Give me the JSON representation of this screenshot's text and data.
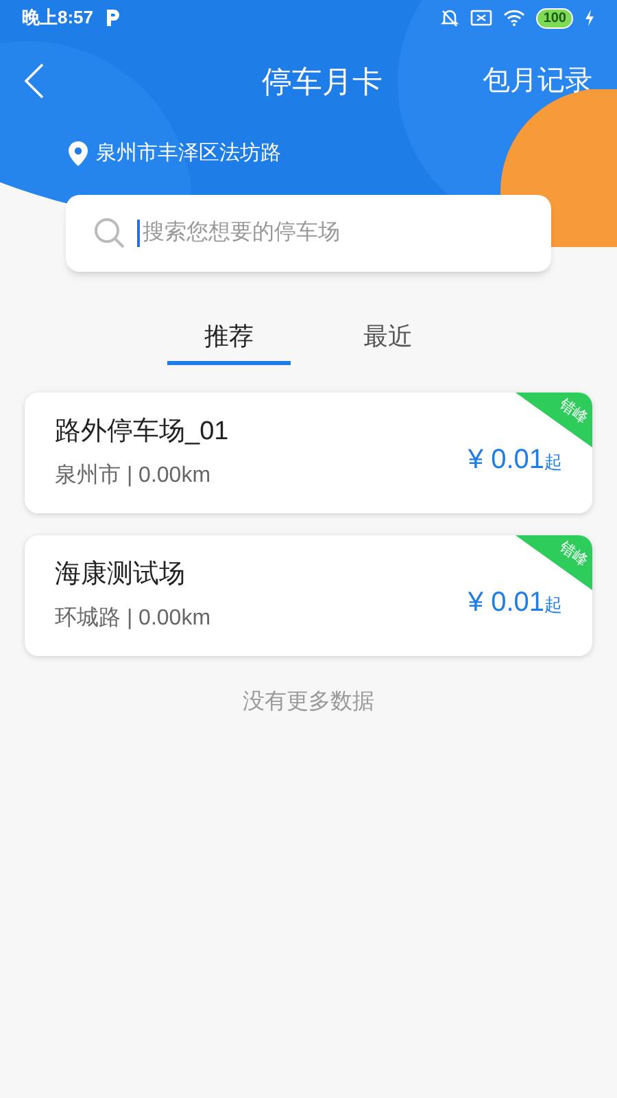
{
  "status_bar": {
    "time": "晚上8:57",
    "battery": "100"
  },
  "header": {
    "title": "停车月卡",
    "action": "包月记录",
    "location": "泉州市丰泽区法坊路"
  },
  "search": {
    "placeholder": "搜索您想要的停车场"
  },
  "tabs": [
    {
      "label": "推荐",
      "selected": true
    },
    {
      "label": "最近",
      "selected": false
    }
  ],
  "lots": [
    {
      "name": "路外停车场_01",
      "detail": "泉州市 | 0.00km",
      "price": "¥ 0.01",
      "suffix": "起",
      "tag": "错峰"
    },
    {
      "name": "海康测试场",
      "detail": "环城路 | 0.00km",
      "price": "¥ 0.01",
      "suffix": "起",
      "tag": "错峰"
    }
  ],
  "footer": "没有更多数据"
}
